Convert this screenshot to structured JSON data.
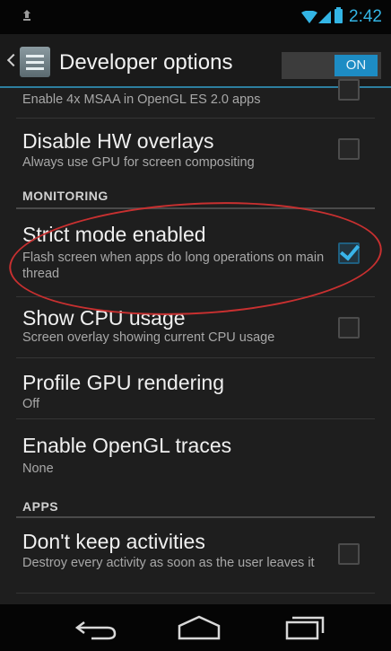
{
  "status_bar": {
    "time": "2:42",
    "icons": [
      "notification-icon",
      "wifi-icon",
      "signal-icon",
      "battery-icon"
    ]
  },
  "action_bar": {
    "title": "Developer options",
    "toggle_label": "ON",
    "accent_color": "#33b5e5"
  },
  "partial_top": {
    "summary": "Enable 4x MSAA in OpenGL ES 2.0 apps"
  },
  "prefs": {
    "disable_hw_overlays": {
      "title": "Disable HW overlays",
      "summary": "Always use GPU for screen compositing",
      "checked": false
    },
    "monitoring_header": "MONITORING",
    "strict_mode": {
      "title": "Strict mode enabled",
      "summary": "Flash screen when apps do long operations on main thread",
      "checked": true
    },
    "show_cpu_usage": {
      "title": "Show CPU usage",
      "summary": "Screen overlay showing current CPU usage",
      "checked": false
    },
    "profile_gpu": {
      "title": "Profile GPU rendering",
      "summary": "Off"
    },
    "opengl_traces": {
      "title": "Enable OpenGL traces",
      "summary": "None"
    },
    "apps_header": "APPS",
    "dont_keep_activities": {
      "title": "Don't keep activities",
      "summary": "Destroy every activity as soon as the user leaves it",
      "checked": false
    }
  },
  "annotation": {
    "highlight_color": "#c83030"
  },
  "nav_bar": {
    "buttons": [
      "back-icon",
      "home-icon",
      "recent-apps-icon"
    ]
  }
}
